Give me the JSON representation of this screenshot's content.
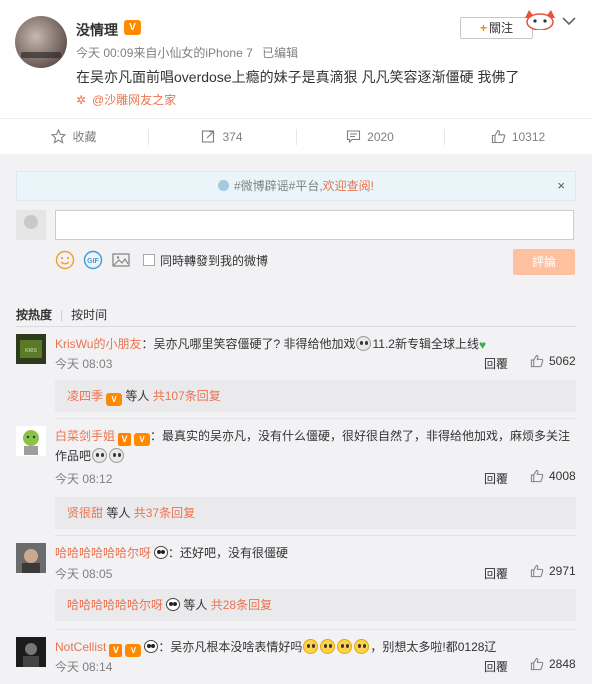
{
  "post": {
    "username": "没情理",
    "time": "今天 00:09",
    "source_prefix": "来自",
    "device": "小仙女的iPhone 7",
    "edited": "已编辑",
    "text": "在吴亦凡面前唱overdose上瘾的妹子是真滴狠 凡凡笑容逐渐僵硬 我佛了",
    "source_link": "@沙雕网友之家",
    "follow_label": "關注"
  },
  "actions": {
    "favorite": "收藏",
    "repost": "374",
    "comment": "2020",
    "like": "10312"
  },
  "notice": {
    "prefix": "#微博辟谣#平台,",
    "link": "欢迎查阅!",
    "close": "×"
  },
  "composer": {
    "repost_label": "同時轉發到我的微博",
    "submit_label": "評論"
  },
  "sort": {
    "hot": "按热度",
    "time": "按时间"
  },
  "comments": [
    {
      "name": "KrisWu的小朋友",
      "text_a": "吴亦凡哪里笑容僵硬了? 非得给他加戏",
      "text_b": "11.2新专辑全球上线",
      "time": "今天 08:03",
      "reply": "回覆",
      "likes": "5062",
      "sub_name": "凌四季",
      "sub_mid": "等人",
      "sub_count": "共107条回复"
    },
    {
      "name": "白菜剑手姐",
      "text_a": "最真实的吴亦凡，没有什么僵硬，很好很自然了，非得给他加戏，麻烦多关注",
      "text_b": "作品吧",
      "time": "今天 08:12",
      "reply": "回覆",
      "likes": "4008",
      "sub_name": "贤很甜",
      "sub_mid": "等人",
      "sub_count": "共37条回复"
    },
    {
      "name": "哈哈哈哈哈哈尔呀",
      "text_a": "还好吧，没有很僵硬",
      "time": "今天 08:05",
      "reply": "回覆",
      "likes": "2971",
      "sub_name": "哈哈哈哈哈哈尔呀",
      "sub_mid": "等人",
      "sub_count": "共28条回复"
    },
    {
      "name": "NotCellist",
      "text_a": "吴亦凡根本没啥表情好吗",
      "text_b": "，别想太多啦!都0128辽",
      "time": "今天 08:14",
      "reply": "回覆",
      "likes": "2848"
    }
  ],
  "colors": {
    "link": "#eb7350",
    "follow_plus": "#ff8200",
    "comment_bg": "#f2f2f5",
    "submit_bg": "#ffc09f"
  }
}
